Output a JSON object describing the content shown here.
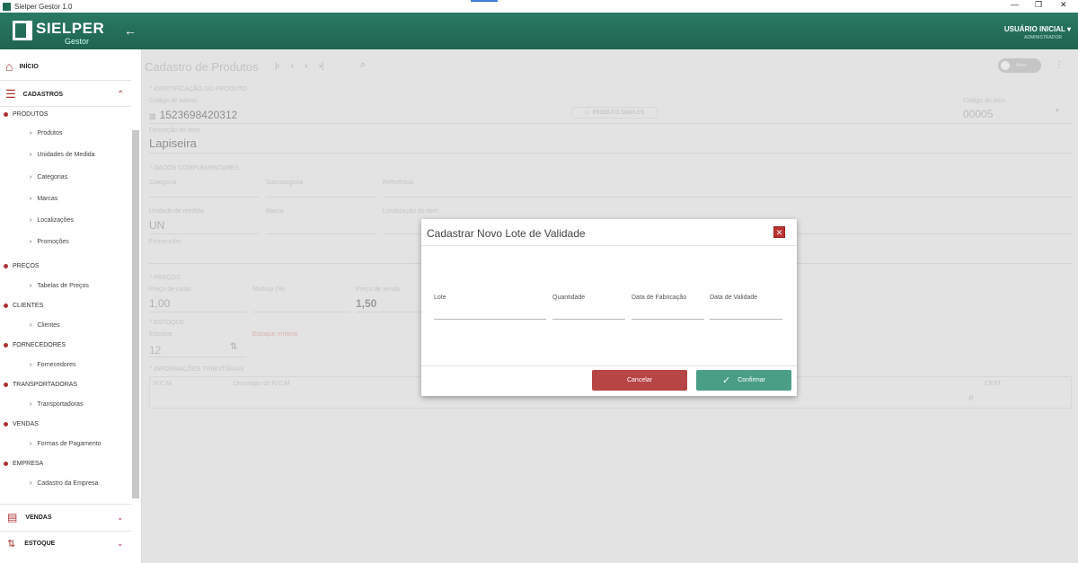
{
  "window": {
    "title": "Sielper Gestor 1.0",
    "minimize": "—",
    "restore": "❐",
    "close": "✕"
  },
  "header": {
    "logo": "SIELPER",
    "logo_sub": "Gestor",
    "back": "←",
    "user": "USUÁRIO INICIAL ▾",
    "role": "ADMINISTRADOR"
  },
  "sidebar": {
    "home": "INÍCIO",
    "cadastros": "CADASTROS",
    "groups": [
      {
        "label": "PRODUTOS",
        "items": [
          "Produtos",
          "Unidades de Medida",
          "Categorias",
          "Marcas",
          "Localizações",
          "Promoções"
        ]
      },
      {
        "label": "PREÇOS",
        "items": [
          "Tabelas de Preços"
        ]
      },
      {
        "label": "CLIENTES",
        "items": [
          "Clientes"
        ]
      },
      {
        "label": "FORNECEDORES",
        "items": [
          "Fornecedores"
        ]
      },
      {
        "label": "TRANSPORTADORAS",
        "items": [
          "Transportadoras"
        ]
      },
      {
        "label": "VENDAS",
        "items": [
          "Formas de Pagamento"
        ]
      },
      {
        "label": "EMPRESA",
        "items": [
          "Cadastro da Empresa"
        ]
      }
    ],
    "vendas": "VENDAS",
    "estoque": "ESTOQUE"
  },
  "page": {
    "title": "Cadastro de Produtos",
    "nav": "|‹ ‹ › ›|",
    "toggle": "Ativo",
    "sec_ident": "^ IDENTIFICAÇÃO DO PRODUTO",
    "lbl_barcode": "Código de barras",
    "barcode": "1523698420312",
    "badge": "PRODUTO SIMPLES",
    "lbl_code": "Código do item",
    "code": "00005",
    "lbl_desc": "Descrição do item",
    "desc": "Lapiseira",
    "sec_comp": "^ DADOS COMPLEMENTARES",
    "lbl_cat": "Categoria",
    "lbl_subcat": "Subcategoria",
    "lbl_ref": "Referência",
    "lbl_unit": "Unidade de medida",
    "unit": "UN",
    "lbl_brand": "Marca",
    "lbl_loc": "Localização do item",
    "lbl_supplier": "Fornecedor",
    "sec_prices": "^ PREÇOS",
    "lbl_cost": "Preço de custo",
    "cost": "1,00",
    "lbl_markup": "Markup (%)",
    "lbl_sale": "Preço de venda",
    "sale": "1,50",
    "sec_stock": "^ ESTOQUE",
    "lbl_stock": "Estoque",
    "stock": "12",
    "lbl_min": "Estoque mínimo",
    "sec_tax": "^ INFORMAÇÕES TRIBUTÁRIAS",
    "lbl_ncm": "N.C.M",
    "lbl_ncm_desc": "Descrição do N.C.M",
    "lbl_cest": "CEST"
  },
  "modal": {
    "title": "Cadastrar Novo Lote de Validade",
    "close": "✕",
    "lote": "Lote",
    "quantidade": "Quantidade",
    "fabricacao": "Data de Fabricação",
    "validade": "Data de Validade",
    "cancel": "Cancelar",
    "confirm": "Confirmar"
  },
  "colors": {
    "header": "#1f6350",
    "accent": "#a33333",
    "confirm": "#4a9e86",
    "cancel": "#b74545"
  }
}
